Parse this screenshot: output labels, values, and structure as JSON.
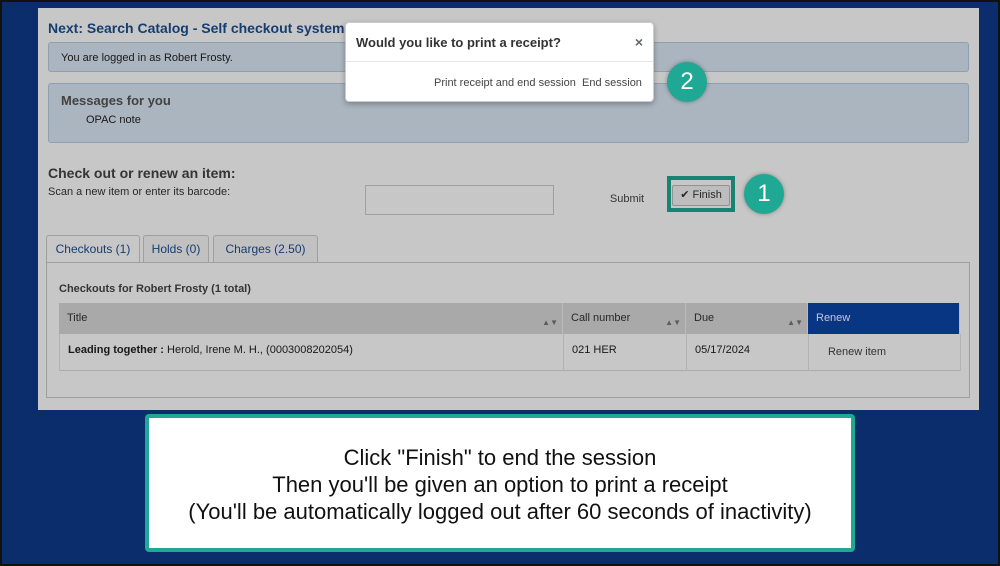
{
  "page": {
    "title": "Next: Search Catalog - Self checkout system",
    "logged_in_text": "You are logged in as Robert Frosty.",
    "messages_title": "Messages for you",
    "messages": [
      "OPAC note"
    ]
  },
  "checkout": {
    "heading": "Check out or renew an item:",
    "scan_label": "Scan a new item or enter its barcode:",
    "barcode_value": "",
    "submit_label": "Submit",
    "finish_label": "Finish",
    "finish_icon": "check-icon"
  },
  "tabs": [
    {
      "label": "Checkouts (1)",
      "active": true
    },
    {
      "label": "Holds (0)",
      "active": false
    },
    {
      "label": "Charges (2.50)",
      "active": false
    }
  ],
  "checkouts": {
    "heading": "Checkouts for Robert Frosty (1 total)",
    "columns": [
      "Title",
      "Call number",
      "Due",
      "Renew"
    ],
    "rows": [
      {
        "title_bold": "Leading together :",
        "title_rest": " Herold, Irene M. H., (0003008202054)",
        "call_number": "021 HER",
        "due": "05/17/2024",
        "renew_label": "Renew item"
      }
    ]
  },
  "modal": {
    "title": "Would you like to print a receipt?",
    "close": "×",
    "print_button": "Print receipt and end session",
    "end_button": "End session"
  },
  "callouts": {
    "badge_1": "1",
    "badge_2": "2",
    "caption_lines": [
      "Click \"Finish\" to end the session",
      "Then you'll be given an option to print a receipt",
      "(You'll be automatically logged out after 60 seconds of inactivity)"
    ]
  },
  "colors": {
    "frame_background": "#0b2d6b",
    "accent_teal": "#1fa893",
    "title_blue": "#1d4f91",
    "renew_header": "#0b46a8"
  }
}
